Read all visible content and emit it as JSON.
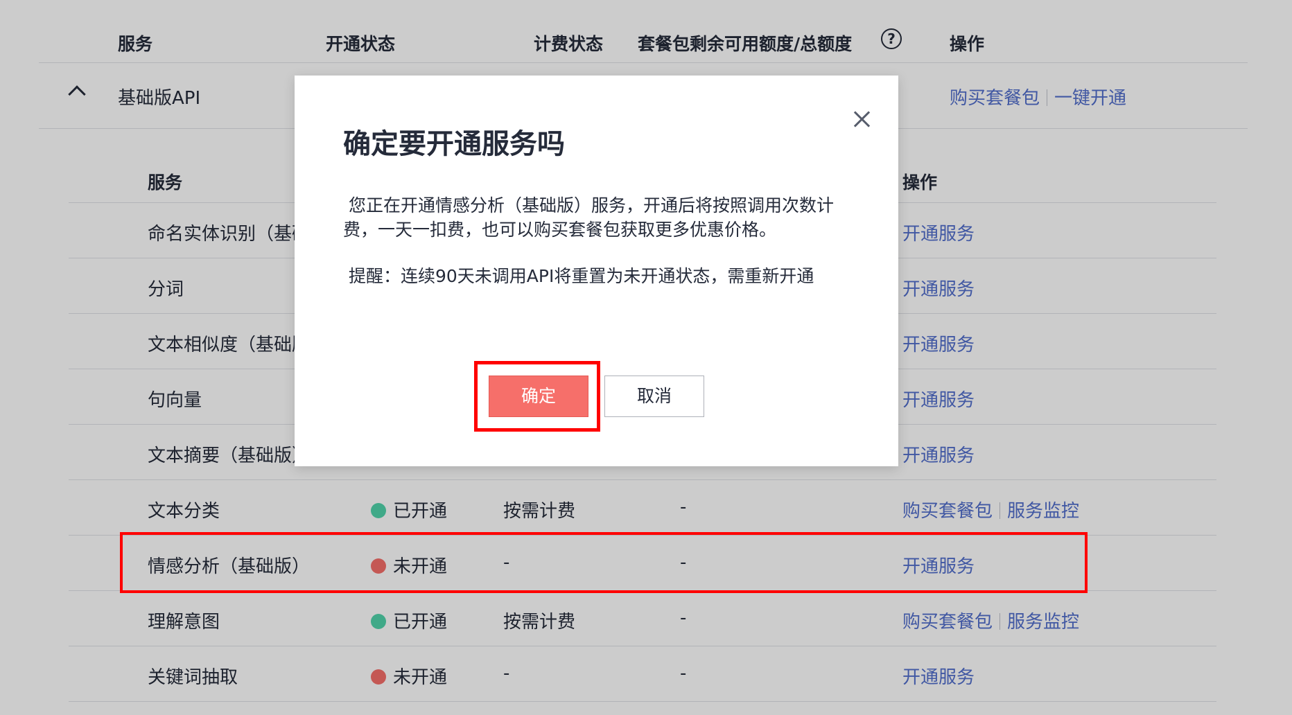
{
  "outer_table": {
    "headers": {
      "service": "服务",
      "status": "开通状态",
      "billing": "计费状态",
      "quota": "套餐包剩余可用额度/总额度",
      "actions": "操作"
    },
    "help_icon": "question-circle-icon",
    "group": {
      "name": "基础版API",
      "actions": [
        "购买套餐包",
        "一键开通"
      ]
    }
  },
  "inner_table": {
    "headers": {
      "service": "服务",
      "actions": "操作"
    },
    "rows": [
      {
        "name": "命名实体识别（基础版）",
        "status": "",
        "billing": "",
        "quota": "",
        "actions": [
          "开通服务"
        ]
      },
      {
        "name": "分词",
        "status": "",
        "billing": "",
        "quota": "",
        "actions": [
          "开通服务"
        ]
      },
      {
        "name": "文本相似度（基础版）",
        "status": "",
        "billing": "",
        "quota": "",
        "actions": [
          "开通服务"
        ]
      },
      {
        "name": "句向量",
        "status": "",
        "billing": "",
        "quota": "",
        "actions": [
          "开通服务"
        ]
      },
      {
        "name": "文本摘要（基础版）",
        "status": "",
        "billing": "",
        "quota": "",
        "actions": [
          "开通服务"
        ]
      },
      {
        "name": "文本分类",
        "status": "已开通",
        "billing": "按需计费",
        "quota": "-",
        "actions": [
          "购买套餐包",
          "服务监控"
        ]
      },
      {
        "name": "情感分析（基础版）",
        "status": "未开通",
        "billing": "-",
        "quota": "-",
        "actions": [
          "开通服务"
        ]
      },
      {
        "name": "理解意图",
        "status": "已开通",
        "billing": "按需计费",
        "quota": "-",
        "actions": [
          "购买套餐包",
          "服务监控"
        ]
      },
      {
        "name": "关键词抽取",
        "status": "未开通",
        "billing": "-",
        "quota": "-",
        "actions": [
          "开通服务"
        ]
      }
    ]
  },
  "colors": {
    "link": "#526ecc",
    "status_on": "#50d4ab",
    "status_off": "#f66f6a",
    "highlight": "#ff0000"
  },
  "modal": {
    "title": "确定要开通服务吗",
    "body": "您正在开通情感分析（基础版）服务，开通后将按照调用次数计费，一天一扣费，也可以购买套餐包获取更多优惠价格。",
    "reminder": "提醒：连续90天未调用API将重置为未开通状态，需重新开通",
    "ok_label": "确定",
    "cancel_label": "取消",
    "close_icon": "close-icon"
  }
}
